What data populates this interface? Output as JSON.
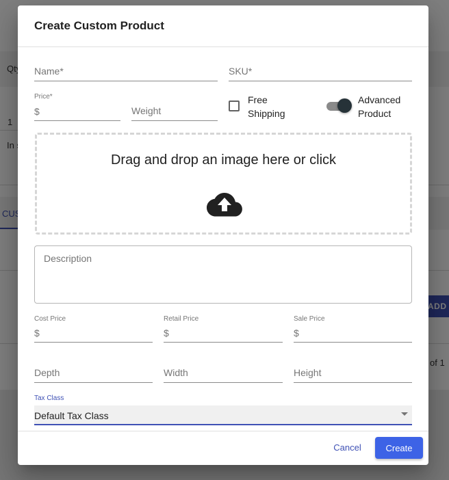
{
  "background": {
    "qty_label": "Qty",
    "qty_value": "1",
    "stock_text": "In s",
    "tab_label": "CUS",
    "add_button": "ADD T",
    "pagination": "of 1"
  },
  "dialog": {
    "title": "Create Custom Product",
    "name": {
      "label": "Name",
      "required_mark": "*",
      "value": ""
    },
    "sku": {
      "label": "SKU",
      "required_mark": "*",
      "value": ""
    },
    "price": {
      "label": "Price",
      "required_mark": "*",
      "prefix": "$",
      "value": ""
    },
    "weight": {
      "placeholder": "Weight",
      "value": ""
    },
    "free_shipping": {
      "label_line1": "Free",
      "label_line2": "Shipping",
      "checked": false
    },
    "advanced_product": {
      "label_line1": "Advanced",
      "label_line2": "Product",
      "on": true
    },
    "dropzone": {
      "text": "Drag and drop an image here or click",
      "icon": "cloud-upload-icon"
    },
    "description": {
      "placeholder": "Description",
      "value": ""
    },
    "cost_price": {
      "label": "Cost Price",
      "prefix": "$",
      "value": ""
    },
    "retail_price": {
      "label": "Retail Price",
      "prefix": "$",
      "value": ""
    },
    "sale_price": {
      "label": "Sale Price",
      "prefix": "$",
      "value": ""
    },
    "depth": {
      "placeholder": "Depth",
      "value": ""
    },
    "width": {
      "placeholder": "Width",
      "value": ""
    },
    "height": {
      "placeholder": "Height",
      "value": ""
    },
    "tax_class": {
      "label": "Tax Class",
      "value": "Default Tax Class"
    },
    "cancel_label": "Cancel",
    "create_label": "Create"
  },
  "colors": {
    "primary": "#3f51b5",
    "create_button": "#3d63e6",
    "toggle_thumb": "#263238"
  }
}
